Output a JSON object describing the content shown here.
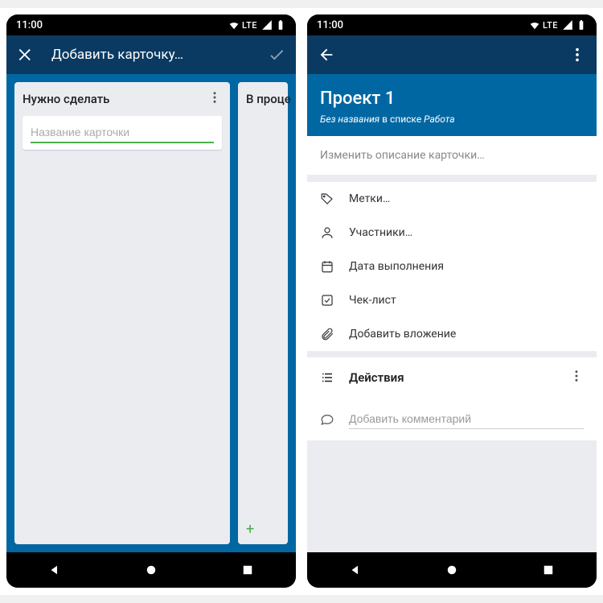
{
  "status": {
    "time": "11:00",
    "network": "LTE"
  },
  "left": {
    "appbar_title": "Добавить карточку…",
    "list1_title": "Нужно сделать",
    "card_placeholder": "Название карточки",
    "list2_title": "В проце"
  },
  "right": {
    "card_title": "Проект 1",
    "sub_notitle": "Без названия",
    "sub_inlist": " в списке ",
    "sub_listname": "Работа",
    "desc_placeholder": "Изменить описание карточки…",
    "opts": {
      "labels": "Метки…",
      "members": "Участники…",
      "due": "Дата выполнения",
      "checklist": "Чек-лист",
      "attach": "Добавить вложение"
    },
    "actions": "Действия",
    "comment_placeholder": "Добавить комментарий"
  }
}
